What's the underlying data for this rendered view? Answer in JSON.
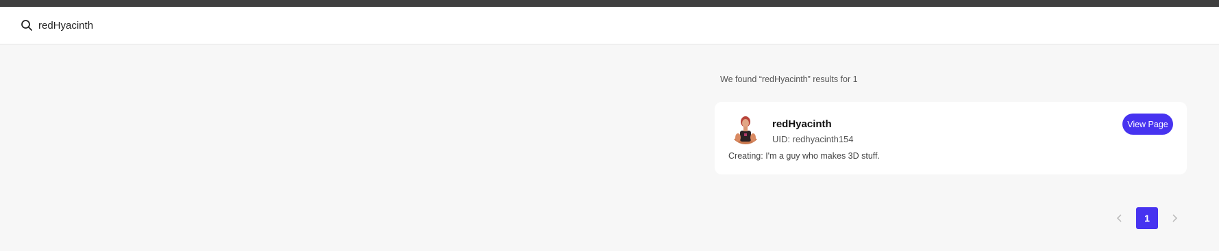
{
  "search": {
    "icon": "search-icon",
    "value": "redHyacinth"
  },
  "results": {
    "summary": "We found “redHyacinth” results for 1",
    "items": [
      {
        "name": "redHyacinth",
        "uid": "UID: redhyacinth154",
        "bio": "Creating: I'm a guy who makes 3D stuff.",
        "button_label": "View Page",
        "avatar": "user-avatar"
      }
    ]
  },
  "pagination": {
    "prev_icon": "chevron-left-icon",
    "current_page": "1",
    "next_icon": "chevron-right-icon"
  },
  "colors": {
    "accent": "#4733f0",
    "topbar": "#3f3f3f",
    "background": "#f7f7f7"
  }
}
